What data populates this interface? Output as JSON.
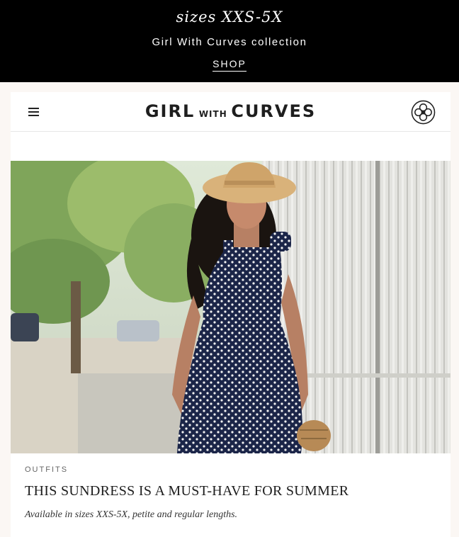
{
  "promo": {
    "script_text": "sizes XXS-5X",
    "subtitle": "Girl With Curves collection",
    "cta_label": "SHOP"
  },
  "header": {
    "logo": {
      "part1": "GIRL",
      "part2": "WITH",
      "part3": "CURVES"
    },
    "menu_icon": "hamburger-menu-icon",
    "emblem_icon": "ornamental-emblem-icon"
  },
  "post": {
    "category": "OUTFITS",
    "title": "THIS SUNDRESS IS A MUST-HAVE FOR SUMMER",
    "excerpt": "Available in sizes XXS-5X, petite and regular lengths."
  },
  "colors": {
    "promo_bg": "#000000",
    "page_bg": "#fbf7f4",
    "dress_navy": "#1b2548",
    "hat_straw": "#d9b27a"
  }
}
